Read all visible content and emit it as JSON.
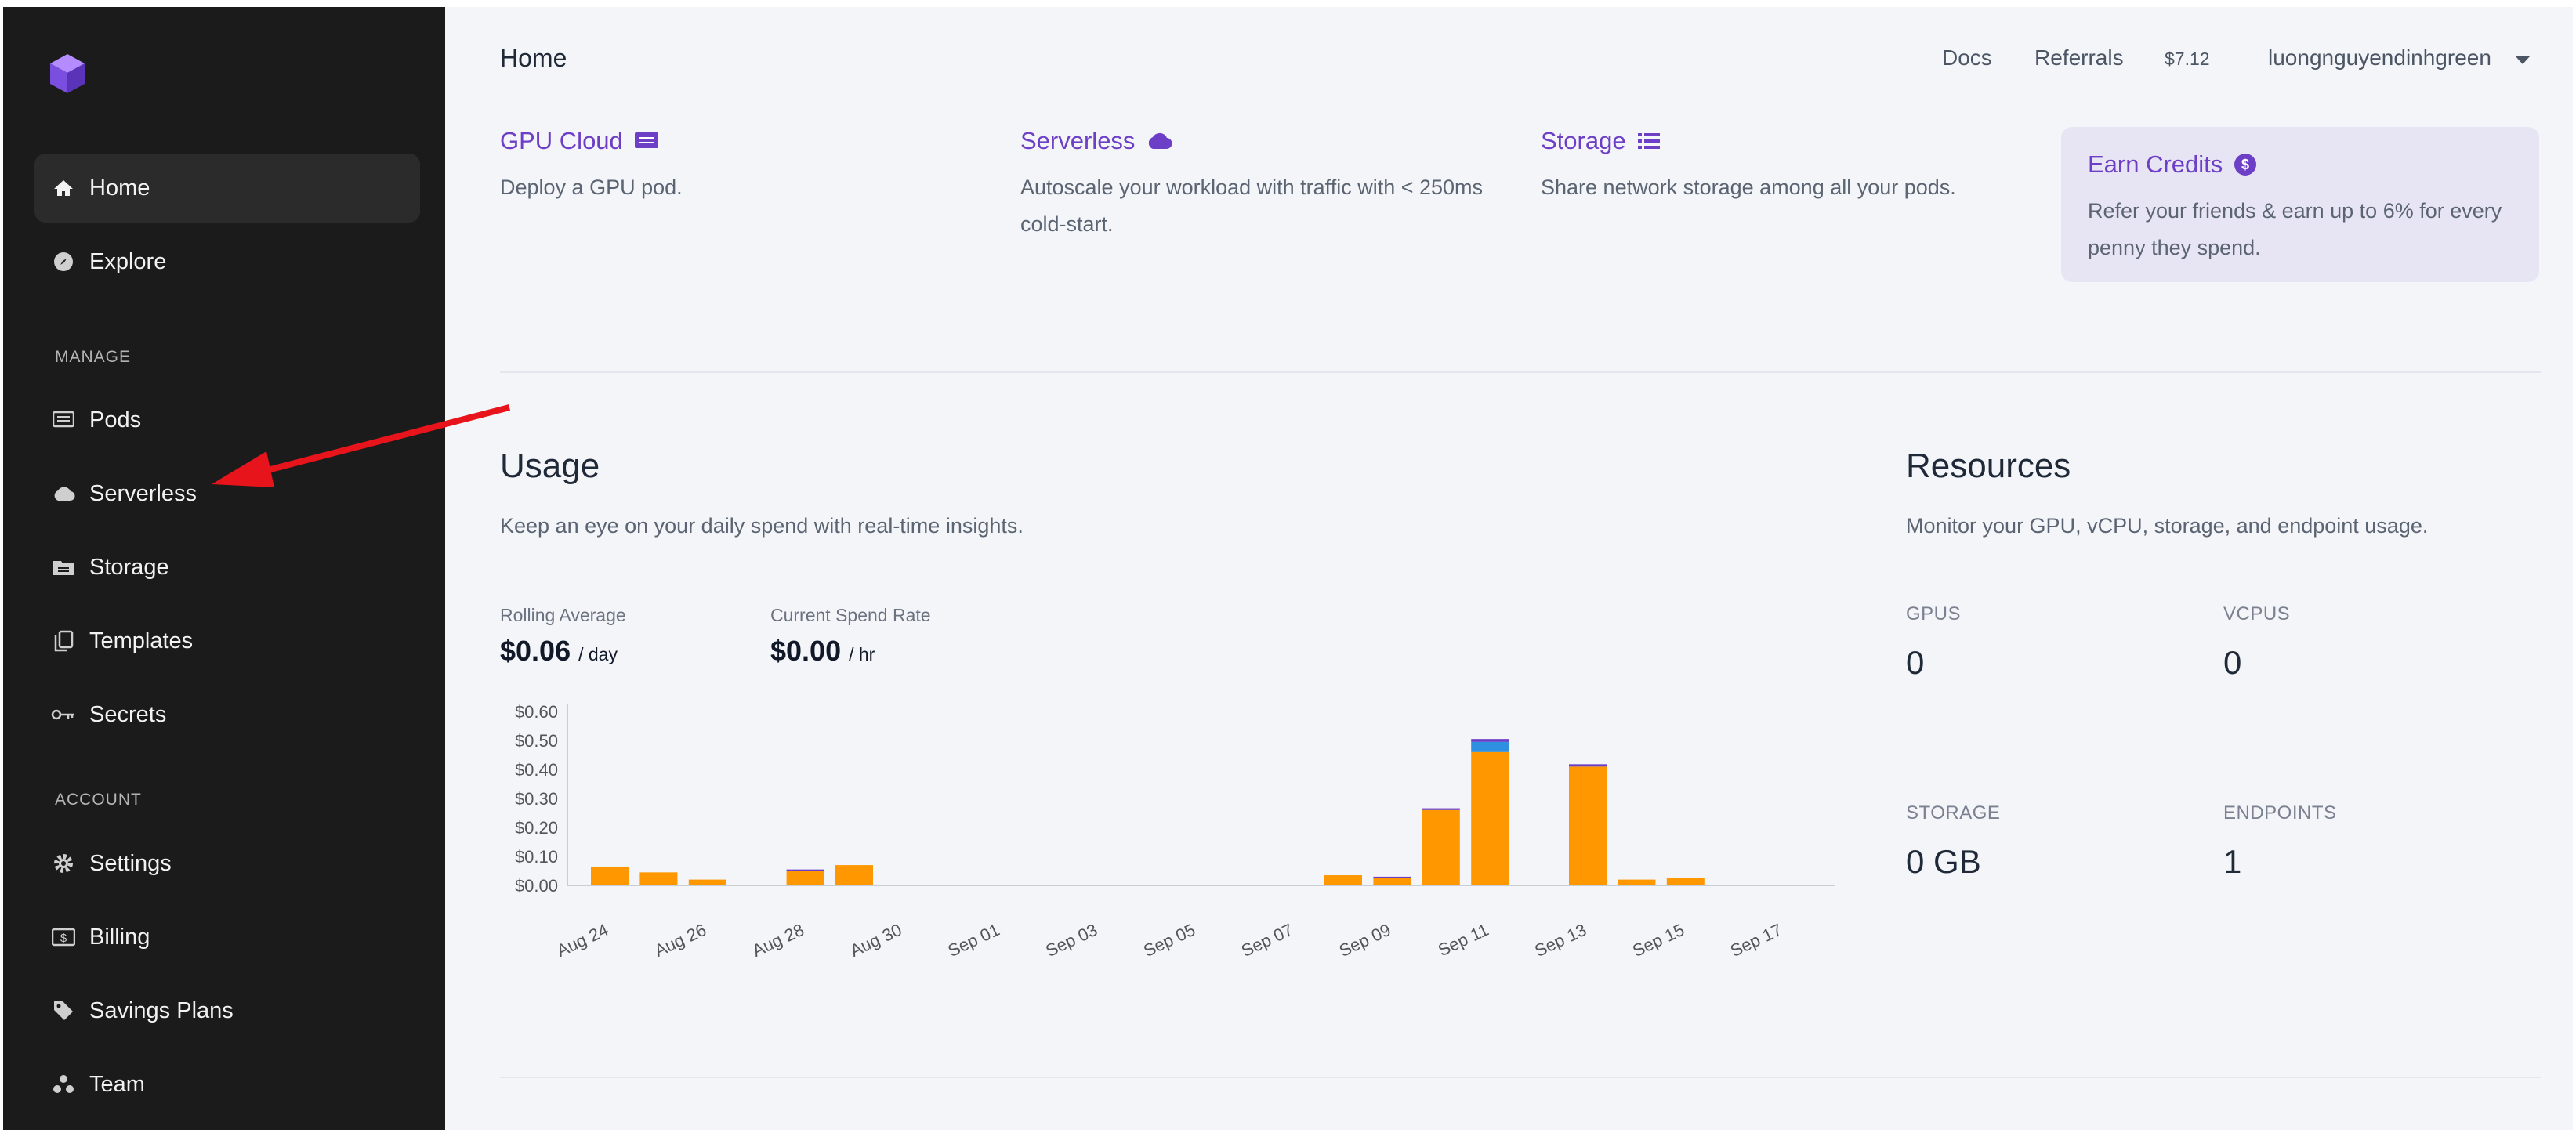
{
  "header": {
    "title": "Home",
    "docs": "Docs",
    "referrals": "Referrals",
    "balance": "$7.12",
    "username": "luongnguyendinhgreen"
  },
  "sidebar": {
    "items": [
      {
        "label": "Home",
        "icon": "home-icon"
      },
      {
        "label": "Explore",
        "icon": "compass-icon"
      }
    ],
    "manage_title": "MANAGE",
    "manage": [
      {
        "label": "Pods",
        "icon": "pods-icon"
      },
      {
        "label": "Serverless",
        "icon": "cloud-icon"
      },
      {
        "label": "Storage",
        "icon": "storage-icon"
      },
      {
        "label": "Templates",
        "icon": "templates-icon"
      },
      {
        "label": "Secrets",
        "icon": "key-icon"
      }
    ],
    "account_title": "ACCOUNT",
    "account": [
      {
        "label": "Settings",
        "icon": "gear-icon"
      },
      {
        "label": "Billing",
        "icon": "billing-icon"
      },
      {
        "label": "Savings Plans",
        "icon": "tag-icon"
      },
      {
        "label": "Team",
        "icon": "team-icon"
      }
    ]
  },
  "cards": [
    {
      "title": "GPU Cloud",
      "desc": "Deploy a GPU pod."
    },
    {
      "title": "Serverless",
      "desc": "Autoscale your workload with traffic with < 250ms cold-start."
    },
    {
      "title": "Storage",
      "desc": "Share network storage among all your pods."
    },
    {
      "title": "Earn Credits",
      "desc": "Refer your friends & earn up to 6% for every penny they spend."
    }
  ],
  "usage": {
    "title": "Usage",
    "subtitle": "Keep an eye on your daily spend with real-time insights.",
    "rolling_label": "Rolling Average",
    "rolling_value": "$0.06",
    "rolling_unit": "/ day",
    "spend_label": "Current Spend Rate",
    "spend_value": "$0.00",
    "spend_unit": "/ hr"
  },
  "resources": {
    "title": "Resources",
    "subtitle": "Monitor your GPU, vCPU, storage, and endpoint usage.",
    "gpus_label": "GPUS",
    "gpus_value": "0",
    "vcpus_label": "VCPUS",
    "vcpus_value": "0",
    "storage_label": "STORAGE",
    "storage_value": "0 GB",
    "endpoints_label": "ENDPOINTS",
    "endpoints_value": "1"
  },
  "colors": {
    "accent": "#6d3fc6",
    "bar_main": "#ff9800",
    "bar_blue": "#2f8fe0",
    "bar_purple": "#6a3fc6",
    "bar_teal": "#26b5a0"
  },
  "chart_data": {
    "type": "bar",
    "stacked": true,
    "categories": [
      "Aug 24",
      "Aug 25",
      "Aug 26",
      "Aug 27",
      "Aug 28",
      "Aug 29",
      "Aug 30",
      "Aug 31",
      "Sep 01",
      "Sep 02",
      "Sep 03",
      "Sep 04",
      "Sep 05",
      "Sep 06",
      "Sep 07",
      "Sep 08",
      "Sep 09",
      "Sep 10",
      "Sep 11",
      "Sep 12",
      "Sep 13",
      "Sep 14",
      "Sep 15",
      "Sep 16",
      "Sep 17",
      "Sep 18"
    ],
    "tick_labels": [
      "Aug 24",
      "Aug 26",
      "Aug 28",
      "Aug 30",
      "Sep 01",
      "Sep 03",
      "Sep 05",
      "Sep 07",
      "Sep 09",
      "Sep 11",
      "Sep 13",
      "Sep 15",
      "Sep 17"
    ],
    "series": [
      {
        "color": "#ff9800",
        "values": [
          0.065,
          0.045,
          0.02,
          0,
          0.05,
          0.07,
          0,
          0,
          0,
          0,
          0,
          0,
          0,
          0,
          0,
          0.035,
          0.025,
          0.26,
          0.46,
          0,
          0.41,
          0.02,
          0.025,
          0,
          0,
          0
        ]
      },
      {
        "color": "#2f8fe0",
        "values": [
          0,
          0,
          0,
          0,
          0,
          0,
          0,
          0,
          0,
          0,
          0,
          0,
          0,
          0,
          0,
          0,
          0,
          0,
          0.035,
          0,
          0,
          0,
          0,
          0,
          0,
          0
        ]
      },
      {
        "color": "#6a3fc6",
        "values": [
          0,
          0,
          0,
          0,
          0.005,
          0,
          0,
          0,
          0,
          0,
          0,
          0,
          0,
          0,
          0,
          0,
          0.005,
          0.006,
          0.01,
          0,
          0.008,
          0,
          0,
          0,
          0,
          0
        ]
      }
    ],
    "ylim": [
      0,
      0.6
    ],
    "yticks": [
      "$0.00",
      "$0.10",
      "$0.20",
      "$0.30",
      "$0.40",
      "$0.50",
      "$0.60"
    ]
  }
}
